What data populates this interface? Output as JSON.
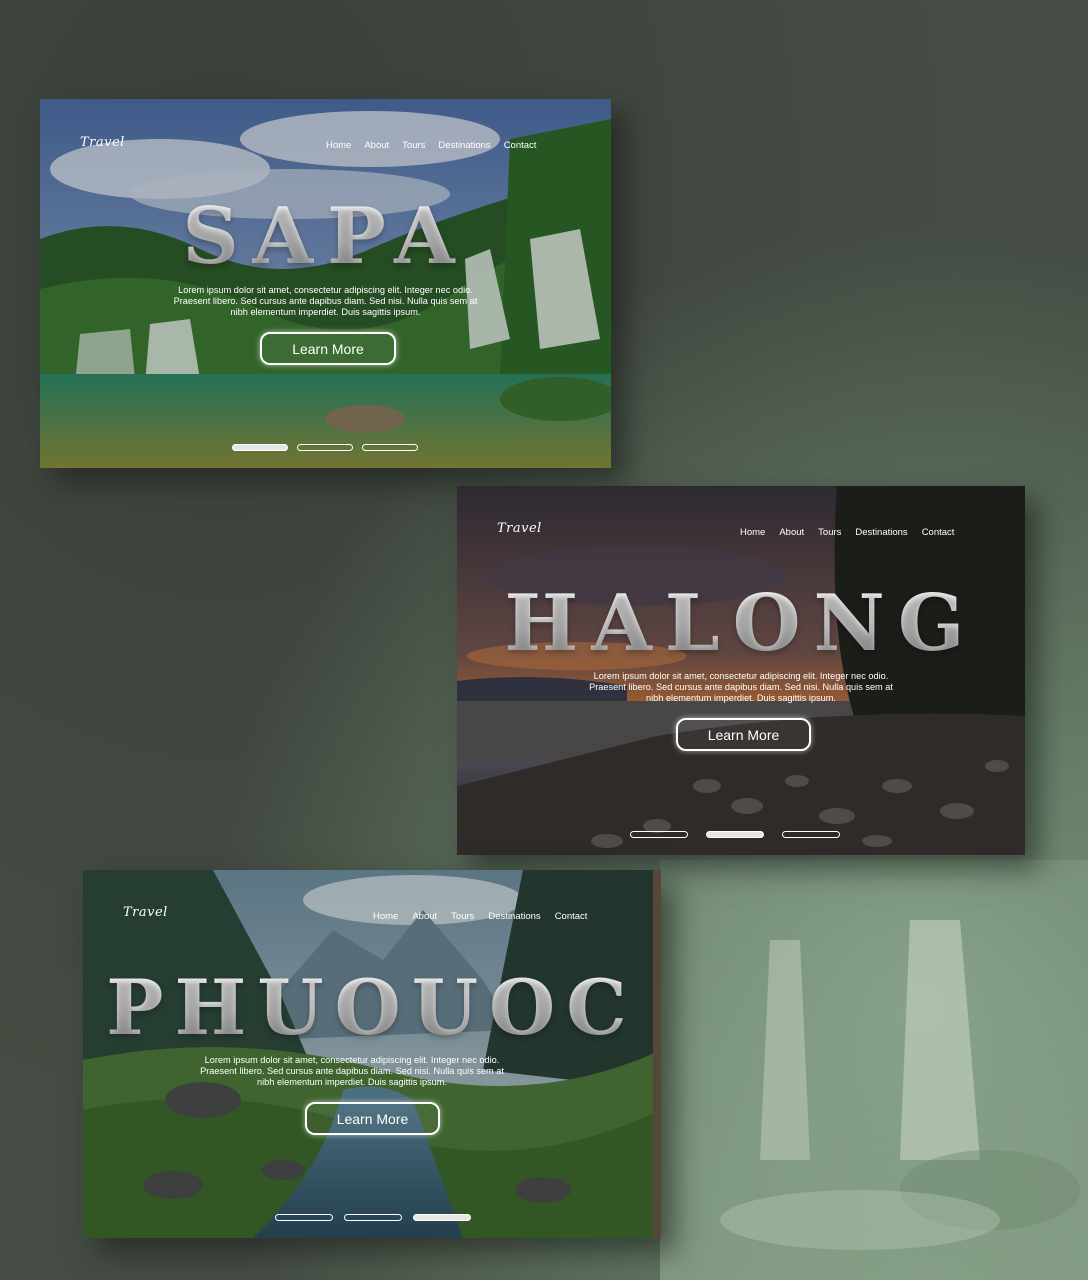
{
  "cards": [
    {
      "logo": "Travel",
      "nav": [
        "Home",
        "About",
        "Tours",
        "Destinations",
        "Contact"
      ],
      "title": "SAPA",
      "description_lines": [
        "Lorem ipsum dolor sit amet, consectetur adipiscing elit. Integer nec odio.",
        "Praesent libero. Sed cursus ante dapibus diam. Sed nisi. Nulla quis sem at",
        "nibh elementum imperdiet. Duis sagittis ipsum."
      ],
      "button_label": "Learn More",
      "slides_total": 3,
      "active_slide": 1
    },
    {
      "logo": "Travel",
      "nav": [
        "Home",
        "About",
        "Tours",
        "Destinations",
        "Contact"
      ],
      "title": "HALONG",
      "description_lines": [
        "Lorem ipsum dolor sit amet, consectetur adipiscing elit. Integer nec odio.",
        "Praesent libero. Sed cursus ante dapibus diam. Sed nisi. Nulla quis sem at",
        "nibh elementum imperdiet. Duis sagittis ipsum."
      ],
      "button_label": "Learn More",
      "slides_total": 3,
      "active_slide": 2
    },
    {
      "logo": "Travel",
      "nav": [
        "Home",
        "About",
        "Tours",
        "Destinations",
        "Contact"
      ],
      "title": "PHUOUOC",
      "description_lines": [
        "Lorem ipsum dolor sit amet, consectetur adipiscing elit. Integer nec odio.",
        "Praesent libero. Sed cursus ante dapibus diam. Sed nisi. Nulla quis sem at",
        "nibh elementum imperdiet. Duis sagittis ipsum."
      ],
      "button_label": "Learn More",
      "slides_total": 3,
      "active_slide": 3
    }
  ],
  "colors": {
    "page_background": "#444c43",
    "text": "#ffffff",
    "active_indicator": "#e6e6e6"
  }
}
